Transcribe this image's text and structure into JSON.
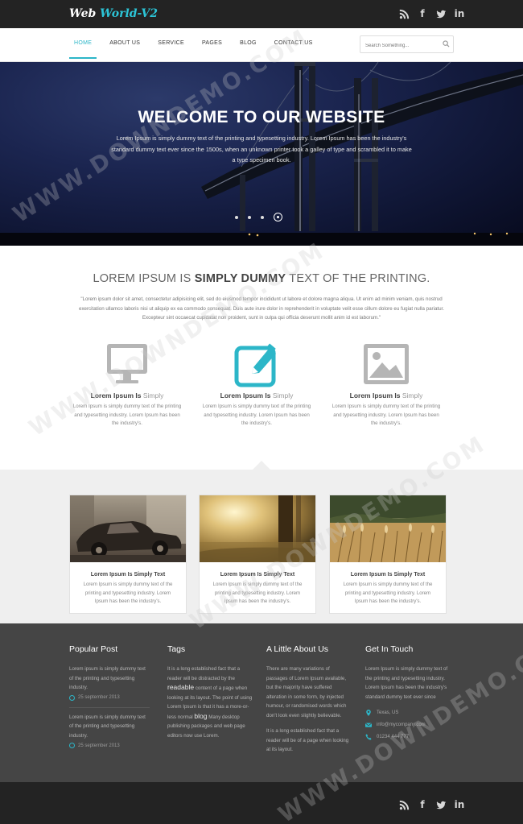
{
  "brand": {
    "logo_prefix": "Web ",
    "logo_suffix": "World-V2"
  },
  "social": {
    "icons": [
      "rss-icon",
      "facebook-icon",
      "twitter-icon",
      "linkedin-icon"
    ]
  },
  "nav": {
    "items": [
      {
        "label": "HOME",
        "active": true
      },
      {
        "label": "ABOUT US",
        "active": false
      },
      {
        "label": "SERVICE",
        "active": false
      },
      {
        "label": "PAGES",
        "active": false
      },
      {
        "label": "BLOG",
        "active": false
      },
      {
        "label": "CONTACT US",
        "active": false
      }
    ],
    "search_placeholder": "Search Something..."
  },
  "hero": {
    "title": "WELCOME TO OUR WEBSITE",
    "text": "Lorem Ipsum is simply dummy text of the printing and typesetting industry. Lorem Ipsum has been the industry's standard dummy text ever since the 1500s, when an unknown printer took a galley of type and scrambled it to make a type specimen book.",
    "slide_count": 4,
    "active_slide": 4
  },
  "intro": {
    "title_pre": "LOREM IPSUM IS ",
    "title_bold": "SIMPLY DUMMY",
    "title_post": " TEXT OF THE PRINTING.",
    "text": "\"Lorem ipsum dolor sit amet, consectetur adipisicing elit, sed do eiusmod tempor incididunt ut labore et dolore magna aliqua. Ut enim ad minim veniam, quis nostrud exercitation ullamco laboris nisi ut aliquip ex ea commodo consequat. Duis aute irure dolor in reprehenderit in voluptate velit esse cillum dolore eu fugiat nulla pariatur. Excepteur sint occaecat cupidatat non proident, sunt in culpa qui officia deserunt mollit anim id est laborum.\""
  },
  "features": [
    {
      "icon": "monitor-icon",
      "title_bold": "Lorem Ipsum Is ",
      "title_light": "Simply",
      "text": "Lorem Ipsum is simply dummy text of the printing and typesetting industry. Lorem Ipsum has been the industry's.",
      "color": "#aaaaaa"
    },
    {
      "icon": "edit-icon",
      "title_bold": "Lorem Ipsum Is ",
      "title_light": "Simply",
      "text": "Lorem Ipsum is simply dummy text of the printing and typesetting industry. Lorem Ipsum has been the industry's.",
      "color": "#2cb6c8"
    },
    {
      "icon": "image-icon",
      "title_bold": "Lorem Ipsum Is ",
      "title_light": "Simply",
      "text": "Lorem Ipsum is simply dummy text of the printing and typesetting industry. Lorem Ipsum has been the industry's.",
      "color": "#aaaaaa"
    }
  ],
  "cards": [
    {
      "image": "vintage-car-photo",
      "title": "Lorem Ipsum Is Simply Text",
      "text": "Lorem Ipsum is simply dummy text of the printing and typesetting industry. Lorem Ipsum has been the industry's."
    },
    {
      "image": "sunlit-forest-photo",
      "title": "Lorem Ipsum Is Simply Text",
      "text": "Lorem Ipsum is simply dummy text of the printing and typesetting industry. Lorem Ipsum has been the industry's."
    },
    {
      "image": "wheat-field-photo",
      "title": "Lorem Ipsum Is Simply Text",
      "text": "Lorem Ipsum is simply dummy text of the printing and typesetting industry. Lorem Ipsum has been the industry's."
    }
  ],
  "footer": {
    "popular": {
      "title": "Popular Post",
      "posts": [
        {
          "text": "Lorem ipsum is simply dummy text of the printing and typesetting industry.",
          "date": "25 september 2013"
        },
        {
          "text": "Lorem ipsum is simply dummy text of the printing and typesetting industry.",
          "date": "25 september 2013"
        }
      ]
    },
    "tags": {
      "title": "Tags",
      "text_1": "It is a long established fact that a reader will be distracted by the",
      "word_1": "readable",
      "text_2": "content of a page when looking at its layout. The point of using Lorem Ipsum is that it has a more-or-less normal",
      "word_2": "blog",
      "text_3": "Many desktop publishing packages and web page editors now use Lorem."
    },
    "about": {
      "title": "A Little About Us",
      "text_1": "There are many variations of passages of Lorem Ipsum available, but the majority have suffered alteration in some form, by injected humour, or randomised words which don't look even slightly believable.",
      "text_2": "It is a long established fact that a reader will be of a page when looking at its layout."
    },
    "contact": {
      "title": "Get In Touch",
      "text": "Lorem Ipsum is simply dummy text of the printing and typesetting industry. Lorem Ipsum has been the industry's standard dummy text ever since",
      "location": "Texas, US",
      "email": "info@mycompany.com",
      "phone": "01234 444 777"
    }
  },
  "colors": {
    "accent": "#2cb6c8",
    "topbar": "#232323",
    "footer": "#454545",
    "gallery_bg": "#efefef"
  },
  "watermark": "WWW.DOWNDEMO.COM"
}
